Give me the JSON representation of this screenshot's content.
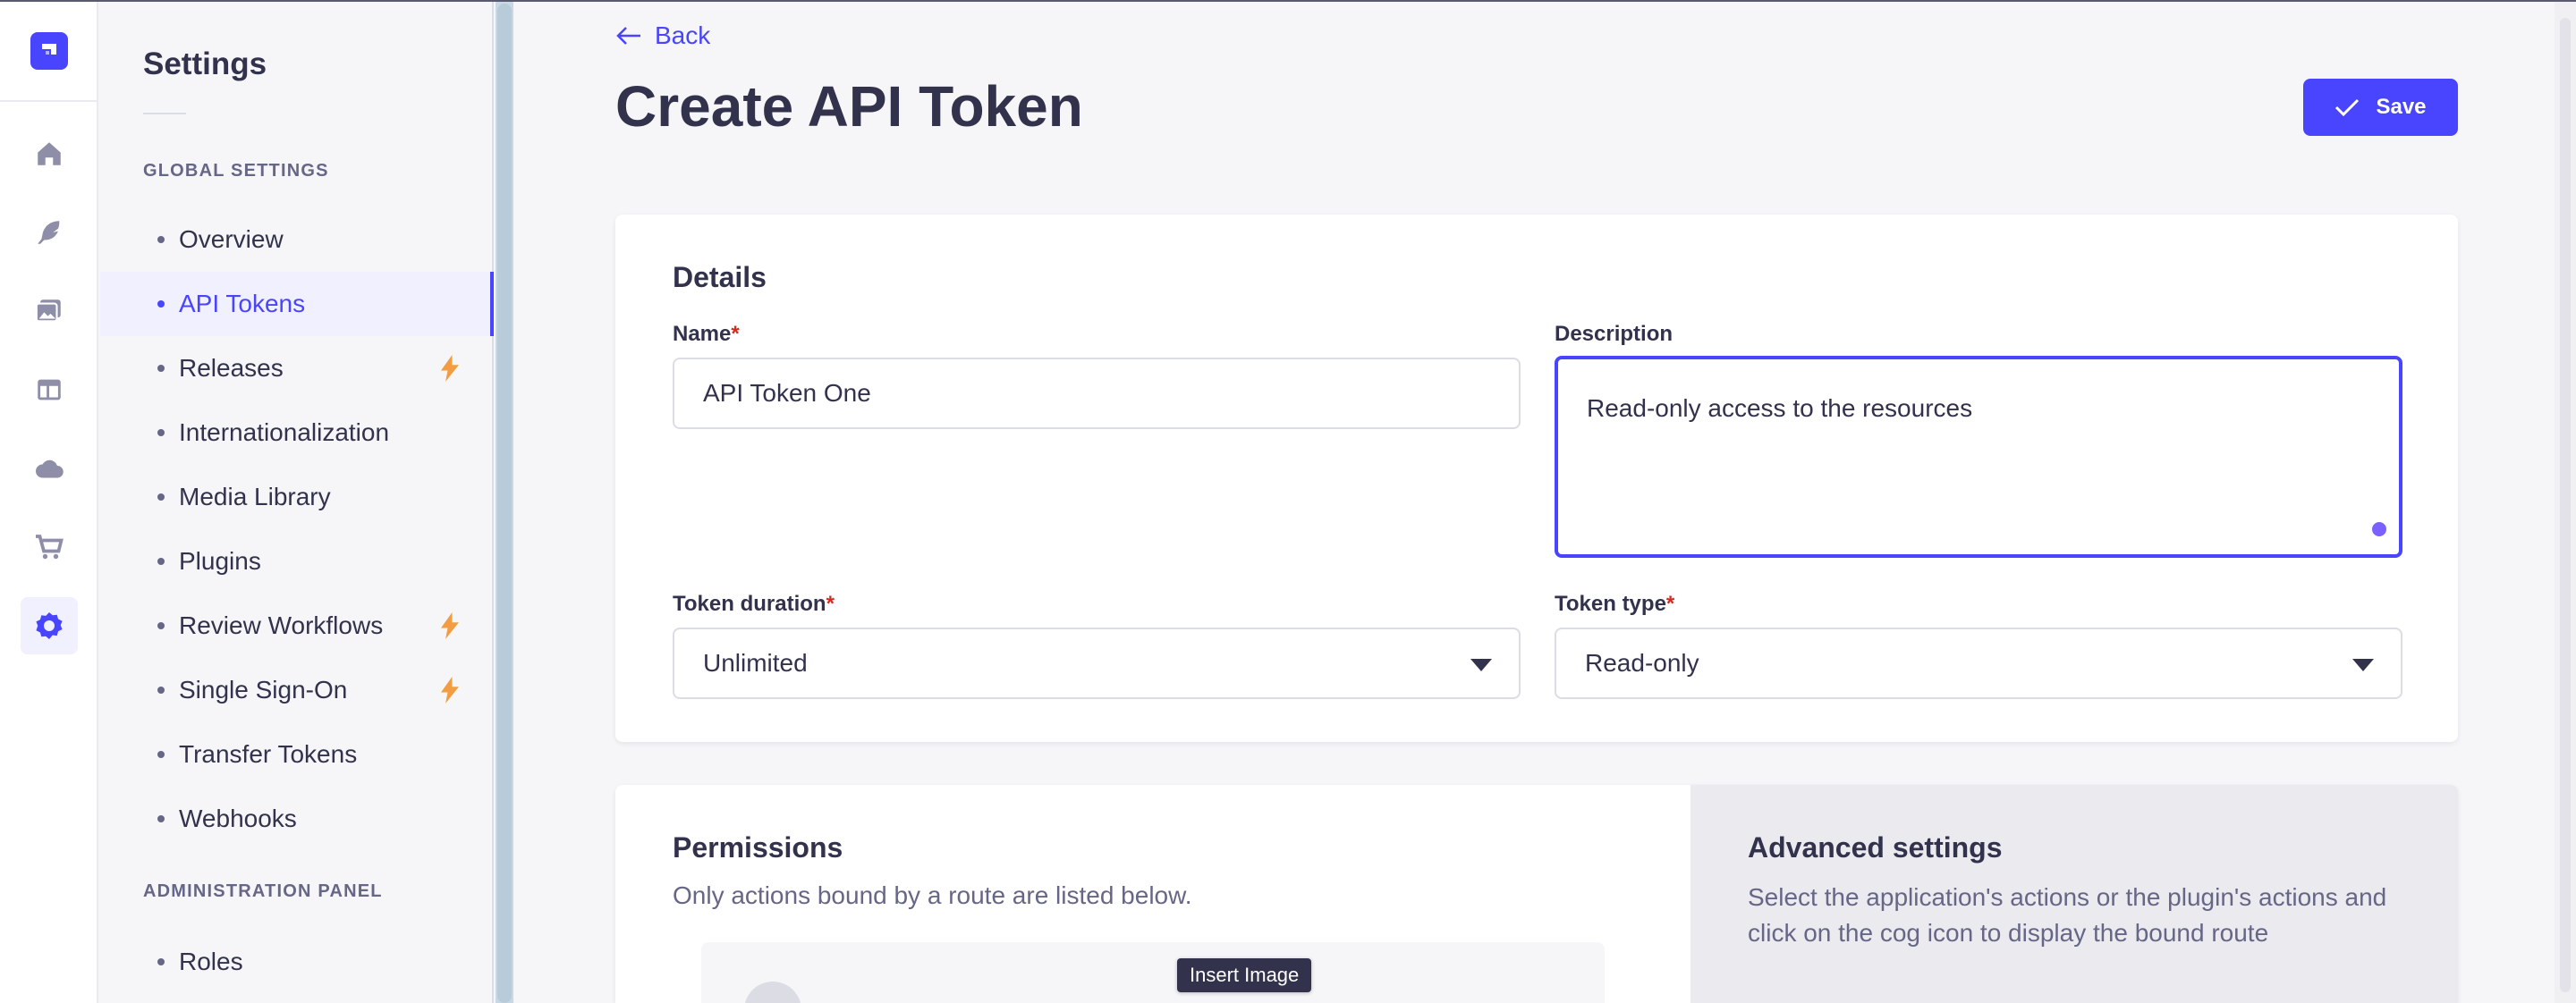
{
  "subnav": {
    "title": "Settings",
    "global_label": "Global Settings",
    "admin_label": "Administration Panel",
    "items": [
      {
        "label": "Overview",
        "active": false,
        "premium": false
      },
      {
        "label": "API Tokens",
        "active": true,
        "premium": false
      },
      {
        "label": "Releases",
        "active": false,
        "premium": true
      },
      {
        "label": "Internationalization",
        "active": false,
        "premium": false
      },
      {
        "label": "Media Library",
        "active": false,
        "premium": false
      },
      {
        "label": "Plugins",
        "active": false,
        "premium": false
      },
      {
        "label": "Review Workflows",
        "active": false,
        "premium": true
      },
      {
        "label": "Single Sign-On",
        "active": false,
        "premium": true
      },
      {
        "label": "Transfer Tokens",
        "active": false,
        "premium": false
      },
      {
        "label": "Webhooks",
        "active": false,
        "premium": false
      }
    ],
    "admin_items": [
      {
        "label": "Roles"
      }
    ]
  },
  "mainnav": {
    "icons": [
      "home-icon",
      "feather-icon",
      "images-icon",
      "layout-icon",
      "cloud-icon",
      "cart-icon",
      "cog-icon"
    ],
    "active": "cog-icon"
  },
  "header": {
    "back_label": "Back",
    "title": "Create API Token",
    "save_label": "Save"
  },
  "details": {
    "title": "Details",
    "name_label": "Name",
    "name_value": "API Token One",
    "description_label": "Description",
    "description_value": "Read-only access to the resources",
    "duration_label": "Token duration",
    "duration_value": "Unlimited",
    "type_label": "Token type",
    "type_value": "Read-only",
    "required_mark": "*"
  },
  "permissions": {
    "title": "Permissions",
    "subtitle": "Only actions bound by a route are listed below."
  },
  "advanced": {
    "title": "Advanced settings",
    "subtitle": "Select the application's actions or the plugin's actions and click on the cog icon to display the bound route"
  },
  "tooltip": {
    "label": "Insert Image"
  },
  "colors": {
    "primary": "#4945ff",
    "premium": "#f29d41",
    "required": "#d02b20",
    "text": "#32324d",
    "muted": "#666687"
  }
}
